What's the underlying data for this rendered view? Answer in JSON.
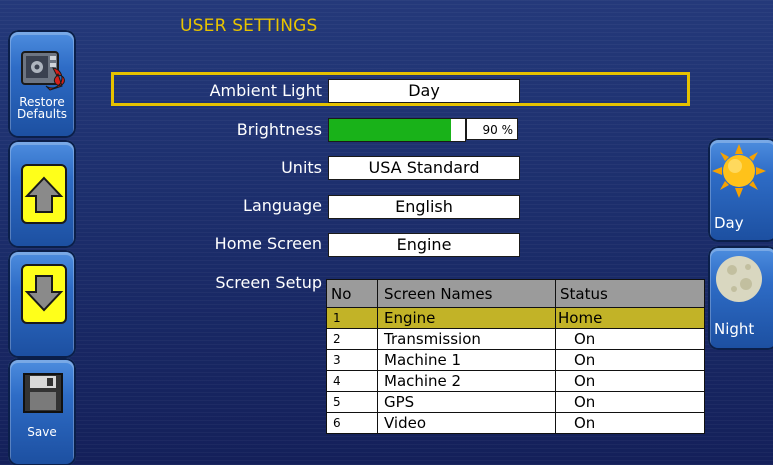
{
  "title": "USER SETTINGS",
  "left_keys": [
    {
      "label_line1": "Restore",
      "label_line2": "Defaults",
      "icon": "restore-defaults-icon"
    },
    {
      "label": "",
      "icon": "arrow-up-icon"
    },
    {
      "label": "",
      "icon": "arrow-down-icon"
    },
    {
      "label": "Save",
      "icon": "save-disk-icon"
    }
  ],
  "right_keys": [
    {
      "label": "Day",
      "icon": "sun-icon"
    },
    {
      "label": "Night",
      "icon": "moon-icon"
    }
  ],
  "settings": {
    "ambient_light": {
      "label": "Ambient Light",
      "value": "Day"
    },
    "brightness": {
      "label": "Brightness",
      "percent": 90,
      "value_text": "90 %"
    },
    "units": {
      "label": "Units",
      "value": "USA Standard"
    },
    "language": {
      "label": "Language",
      "value": "English"
    },
    "home_screen": {
      "label": "Home Screen",
      "value": "Engine"
    },
    "screen_setup": {
      "label": "Screen Setup"
    }
  },
  "screen_table": {
    "headers": [
      "No",
      "Screen Names",
      "Status"
    ],
    "rows": [
      {
        "no": "1",
        "name": "Engine",
        "status": "Home",
        "selected": true
      },
      {
        "no": "2",
        "name": "Transmission",
        "status": "On",
        "selected": false
      },
      {
        "no": "3",
        "name": "Machine 1",
        "status": "On",
        "selected": false
      },
      {
        "no": "4",
        "name": "Machine 2",
        "status": "On",
        "selected": false
      },
      {
        "no": "5",
        "name": "GPS",
        "status": "On",
        "selected": false
      },
      {
        "no": "6",
        "name": "Video",
        "status": "On",
        "selected": false
      }
    ]
  },
  "colors": {
    "background": "#1c2e6c",
    "title": "#e8c400",
    "highlight": "#e6c200",
    "brightness_fill": "#19b219",
    "selected_row": "#c2b327",
    "key_yellow": "#ffff1a"
  }
}
